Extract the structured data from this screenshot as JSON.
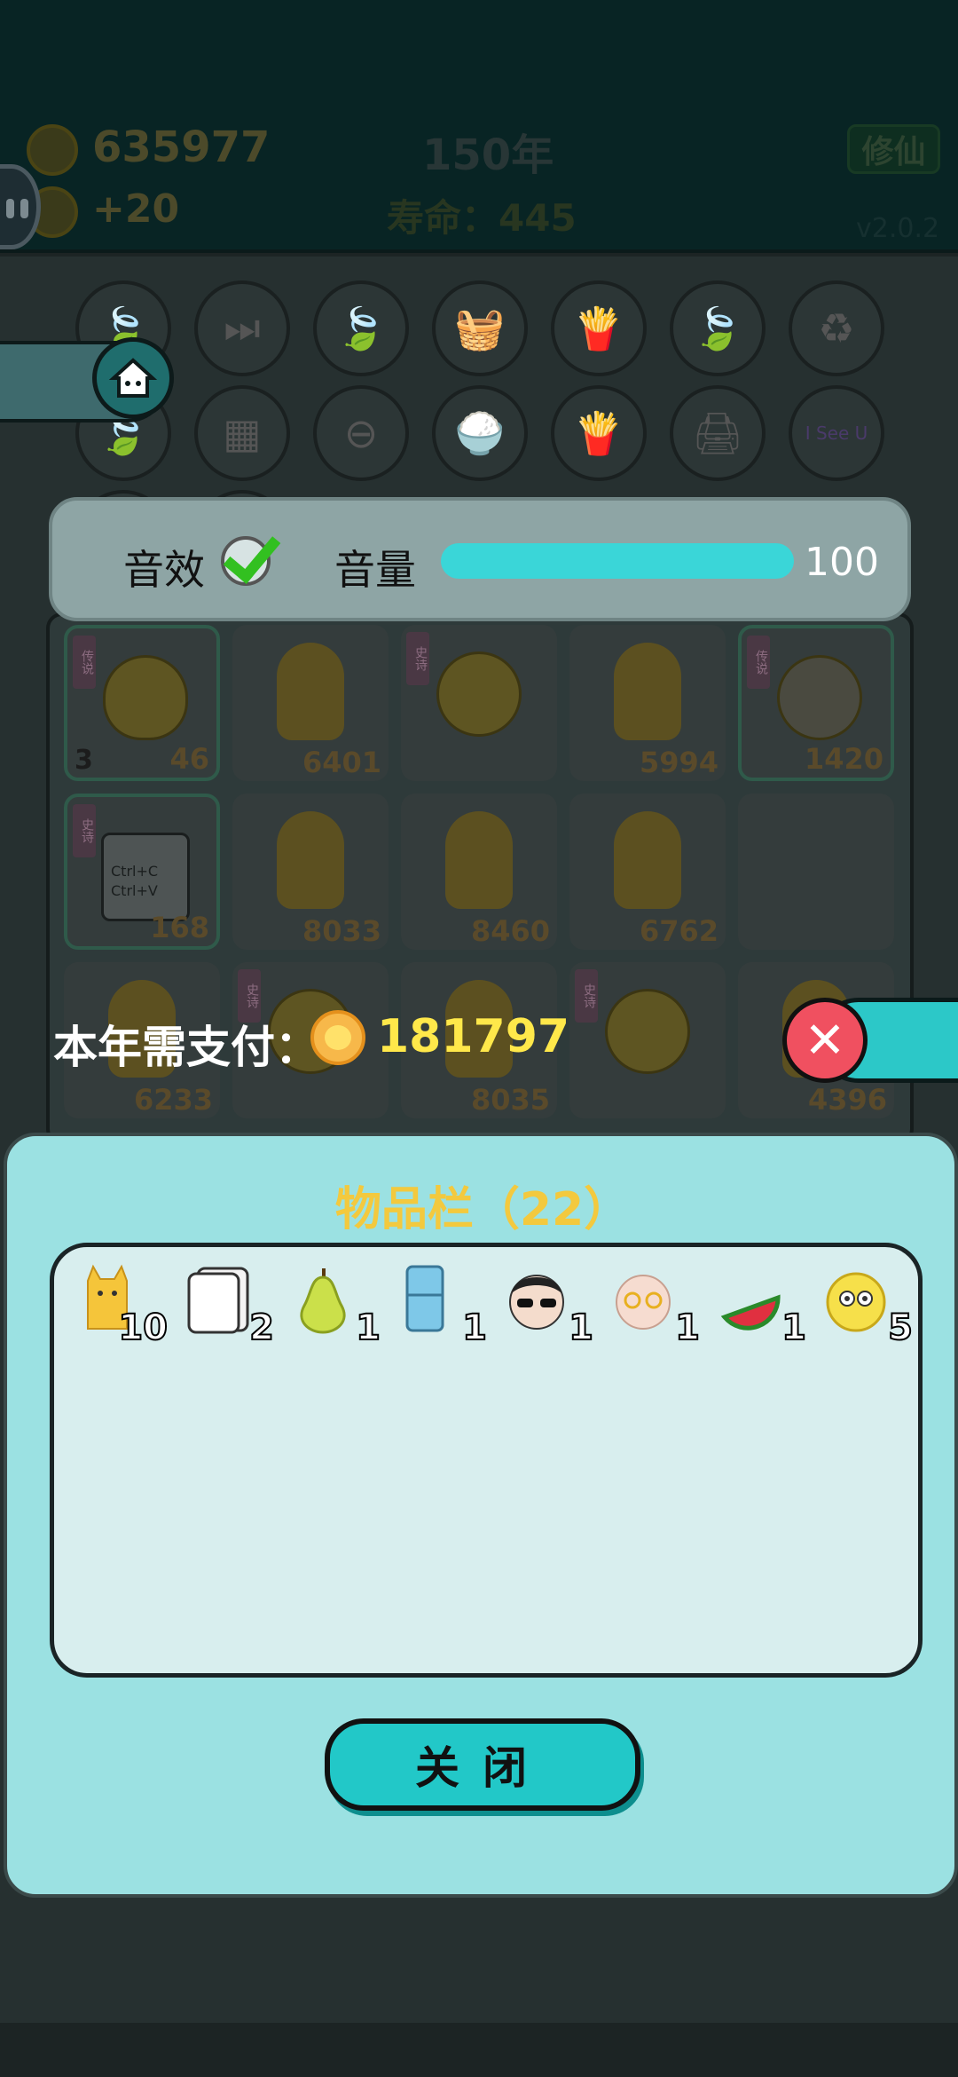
{
  "header": {
    "coins": "635977",
    "income": "+20",
    "year": "150年",
    "lifespan": "寿命：445",
    "cultivate_button": "修仙",
    "version": "v2.0.2"
  },
  "settings": {
    "sound_label": "音效",
    "sound_enabled": true,
    "volume_label": "音量",
    "volume_value": "100",
    "volume_fraction": 1.0
  },
  "grid": {
    "cells": [
      {
        "tag": "传说",
        "count": "3",
        "value": "46"
      },
      {
        "tag": "",
        "count": "",
        "value": "6401"
      },
      {
        "tag": "史诗",
        "count": "",
        "value": ""
      },
      {
        "tag": "",
        "count": "",
        "value": "5994"
      },
      {
        "tag": "传说",
        "count": "",
        "value": "1420"
      },
      {
        "tag": "史诗",
        "count": "",
        "value": "168"
      },
      {
        "tag": "",
        "count": "",
        "value": "8033"
      },
      {
        "tag": "",
        "count": "",
        "value": "8460"
      },
      {
        "tag": "",
        "count": "",
        "value": "6762"
      },
      {
        "tag": "",
        "count": "",
        "value": ""
      },
      {
        "tag": "",
        "count": "",
        "value": "6233"
      },
      {
        "tag": "史诗",
        "count": "",
        "value": ""
      },
      {
        "tag": "",
        "count": "",
        "value": "8035"
      },
      {
        "tag": "史诗",
        "count": "",
        "value": ""
      },
      {
        "tag": "",
        "count": "",
        "value": "4396"
      }
    ],
    "ctrl_text": "Ctrl+C Ctrl+V",
    "isee_text": "I See U"
  },
  "payment": {
    "label": "本年需支付：",
    "amount": "181797"
  },
  "inventory": {
    "title": "物品栏（22）",
    "items": [
      {
        "icon": "cat-icon",
        "count": "10"
      },
      {
        "icon": "ctrl-cv-card-icon",
        "count": "2"
      },
      {
        "icon": "pear-icon",
        "count": "1"
      },
      {
        "icon": "fridge-icon",
        "count": "1"
      },
      {
        "icon": "sunglasses-man-icon",
        "count": "1"
      },
      {
        "icon": "old-man-icon",
        "count": "1"
      },
      {
        "icon": "watermelon-icon",
        "count": "1"
      },
      {
        "icon": "yellow-face-icon",
        "count": "5"
      }
    ],
    "ctrl_card_text": "Ctrl+C Ctrl+V",
    "close_label": "关闭"
  },
  "colors": {
    "accent": "#22c8c8",
    "dialog_bg": "#9be1e2",
    "title_yellow": "#f3c93e",
    "amount_yellow": "#ffe84a",
    "close_red": "#f05060"
  }
}
